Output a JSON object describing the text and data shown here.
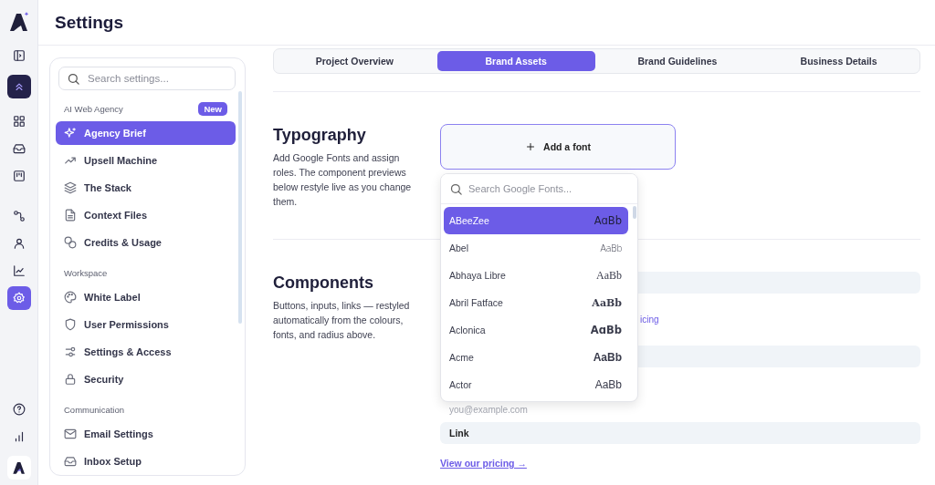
{
  "rail": {
    "items": [
      {
        "selected": false
      },
      {
        "selected": false
      },
      {
        "selected": false
      },
      {
        "selected": false
      },
      {
        "selected": false
      },
      {
        "selected": false
      },
      {
        "selected": false
      },
      {
        "selected": true
      }
    ]
  },
  "header": {
    "title": "Settings"
  },
  "settings_panel": {
    "search": {
      "placeholder": "Search settings..."
    },
    "sections": [
      {
        "label": "AI Web Agency",
        "badge": "New",
        "items": [
          {
            "label": "Agency Brief",
            "selected": true
          },
          {
            "label": "Upsell Machine",
            "selected": false
          },
          {
            "label": "The Stack",
            "selected": false
          },
          {
            "label": "Context Files",
            "selected": false
          },
          {
            "label": "Credits & Usage",
            "selected": false
          }
        ]
      },
      {
        "label": "Workspace",
        "items": [
          {
            "label": "White Label",
            "selected": false
          },
          {
            "label": "User Permissions",
            "selected": false
          },
          {
            "label": "Settings & Access",
            "selected": false
          },
          {
            "label": "Security",
            "selected": false
          }
        ]
      },
      {
        "label": "Communication",
        "items": [
          {
            "label": "Email Settings",
            "selected": false
          },
          {
            "label": "Inbox Setup",
            "selected": false
          }
        ]
      }
    ]
  },
  "tabs": [
    {
      "label": "Project Overview",
      "selected": false
    },
    {
      "label": "Brand Assets",
      "selected": true
    },
    {
      "label": "Brand Guidelines",
      "selected": false
    },
    {
      "label": "Business Details",
      "selected": false
    }
  ],
  "typography": {
    "title": "Typography",
    "description": "Add Google Fonts and assign roles. The component previews below restyle live as you change them.",
    "add_button": "Add a font",
    "font_picker": {
      "search": {
        "placeholder": "Search Google Fonts..."
      },
      "fonts": [
        {
          "name": "ABeeZee",
          "preview": "AɑBb",
          "selected": true
        },
        {
          "name": "Abel",
          "preview": "AaBb",
          "selected": false
        },
        {
          "name": "Abhaya Libre",
          "preview": "AaBb",
          "selected": false
        },
        {
          "name": "Abril Fatface",
          "preview": "AaBb",
          "selected": false
        },
        {
          "name": "Aclonica",
          "preview": "AɑBb",
          "selected": false
        },
        {
          "name": "Acme",
          "preview": "AaBb",
          "selected": false
        },
        {
          "name": "Actor",
          "preview": "AaBb",
          "selected": false
        }
      ]
    }
  },
  "components": {
    "title": "Components",
    "description": "Buttons, inputs, links — restyled automatically from the colours, fonts, and radius above.",
    "link_fragment": "icing",
    "input_placeholder": "you@example.com",
    "link_label": "Link",
    "link": "View our pricing →"
  }
}
